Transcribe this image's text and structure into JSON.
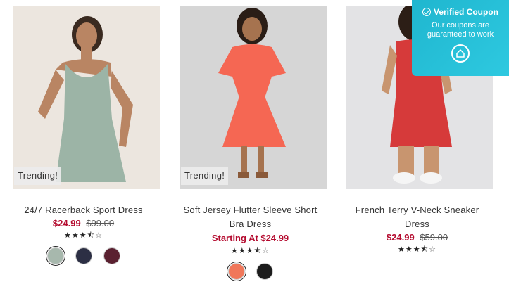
{
  "products": [
    {
      "trending": "Trending!",
      "title": "24/7 Racerback Sport Dress",
      "sale_price": "$24.99",
      "original_price": "$99.00",
      "rating_display": "3.5 of 5",
      "swatches": [
        "#a7b8ad",
        "#2c2f44",
        "#5a2030"
      ],
      "selected_swatch": 0
    },
    {
      "trending": "Trending!",
      "title": "Soft Jersey Flutter Sleeve Short Bra Dress",
      "price_text": "Starting At $24.99",
      "rating_display": "3.5 of 5",
      "swatches": [
        "#f0775a",
        "#1c1c1c"
      ],
      "selected_swatch": 0
    },
    {
      "title": "French Terry V-Neck Sneaker Dress",
      "sale_price": "$24.99",
      "original_price": "$59.00",
      "rating_display": "3.5 of 5"
    }
  ],
  "coupon": {
    "title": "Verified Coupon",
    "subtitle": "Our coupons are guaranteed to work"
  },
  "colors": {
    "sale": "#b40a2e",
    "coupon": "#2ec9e0"
  }
}
